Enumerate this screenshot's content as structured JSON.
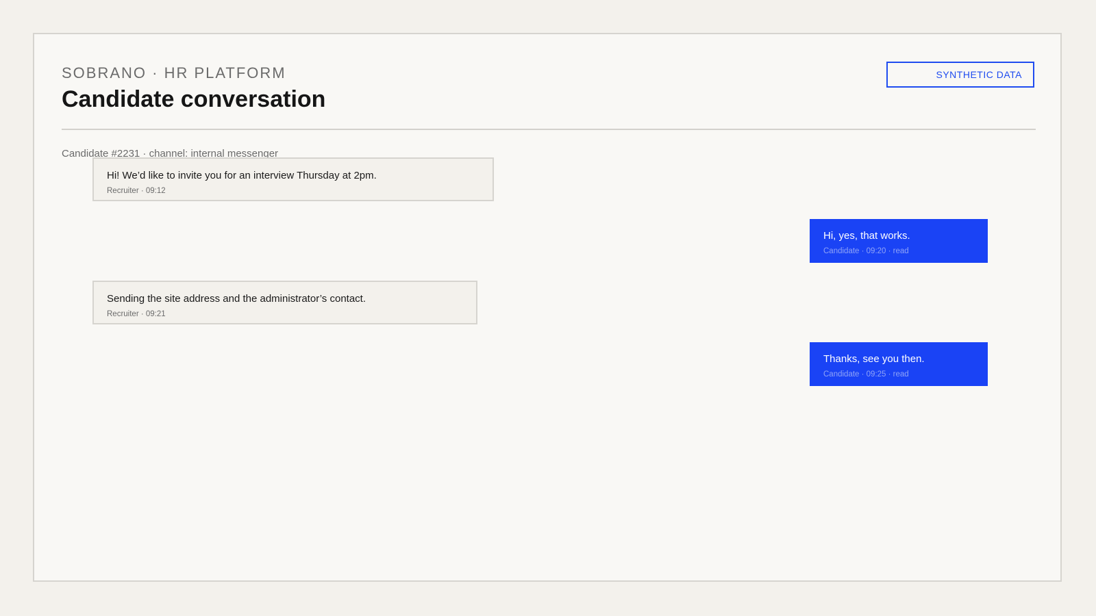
{
  "header": {
    "brand": "SOBRANO · HR PLATFORM",
    "title": "Candidate conversation",
    "badge": "SYNTHETIC DATA"
  },
  "conversation": {
    "meta": "Candidate #2231 · channel: internal messenger",
    "messages": [
      {
        "sender": "recruiter",
        "text": "Hi! We’d like to invite you for an interview Thursday at 2pm.",
        "stamp": "Recruiter · 09:12"
      },
      {
        "sender": "candidate",
        "text": "Hi, yes, that works.",
        "stamp": "Candidate · 09:20 · read"
      },
      {
        "sender": "recruiter",
        "text": "Sending the site address and the administrator’s contact.",
        "stamp": "Recruiter · 09:21"
      },
      {
        "sender": "candidate",
        "text": "Thanks, see you then.",
        "stamp": "Candidate · 09:25 · read"
      }
    ]
  },
  "colors": {
    "accent": "#1a43f5",
    "background": "#f3f1ec",
    "panel": "#f9f8f5"
  }
}
